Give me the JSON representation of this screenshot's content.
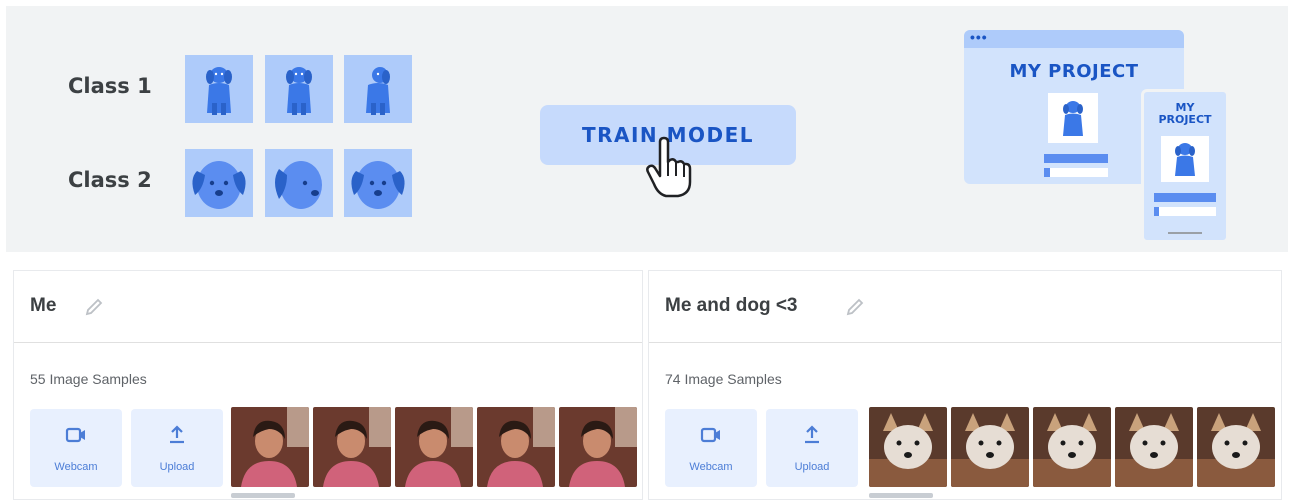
{
  "banner": {
    "class1_label": "Class 1",
    "class2_label": "Class 2",
    "train_button_label": "TRAIN MODEL",
    "browser_title": "MY PROJECT",
    "phone_title_line1": "MY",
    "phone_title_line2": "PROJECT",
    "browser_dots": "•••"
  },
  "panels": [
    {
      "title": "Me",
      "samples_label": "55 Image Samples",
      "webcam_label": "Webcam",
      "upload_label": "Upload"
    },
    {
      "title": "Me and dog <3",
      "samples_label": "74 Image Samples",
      "webcam_label": "Webcam",
      "upload_label": "Upload"
    }
  ],
  "colors": {
    "banner_bg": "#f1f3f4",
    "tile_bg": "#aecbfa",
    "accent": "#1a55c4",
    "dog_blue": "#3b78e7"
  },
  "icons": [
    "dog-sitting-icon",
    "dog-face-icon",
    "hand-pointer-icon",
    "pencil-icon",
    "webcam-icon",
    "upload-icon"
  ]
}
